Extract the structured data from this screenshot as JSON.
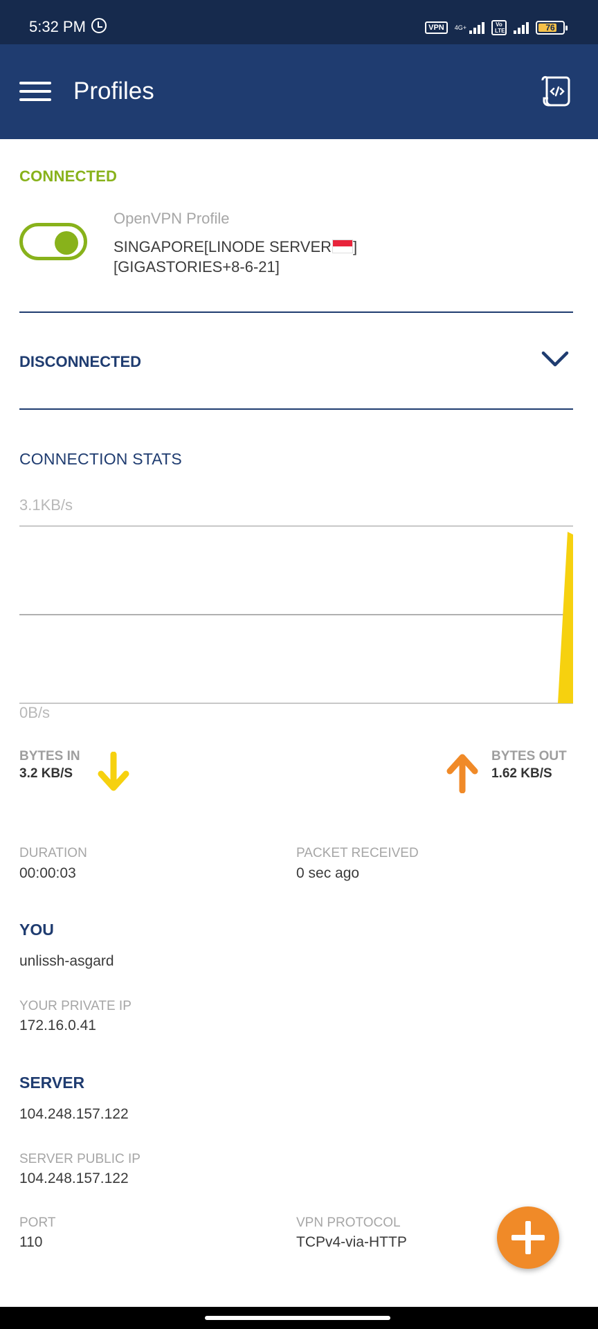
{
  "status_bar": {
    "time": "5:32 PM",
    "vpn_badge": "VPN",
    "network_type": "4G+",
    "volte_badge": "Vo LTE",
    "battery_level": "76",
    "battery_fraction": 0.76
  },
  "app_bar": {
    "title": "Profiles",
    "menu_icon": "hamburger-menu-icon",
    "log_icon": "log-file-icon"
  },
  "connected_section": {
    "label": "CONNECTED",
    "toggle_on": true,
    "profile_type": "OpenVPN Profile",
    "profile_name_line1": "SINGAPORE[LINODE SERVER",
    "profile_name_line2": "[GIGASTORIES+8-6-21]"
  },
  "disconnected_section": {
    "label": "DISCONNECTED"
  },
  "connection_stats": {
    "label": "CONNECTION STATS",
    "max_label": "3.1KB/s",
    "min_label": "0B/s",
    "bytes_in_label": "BYTES IN",
    "bytes_in_value": "3.2 KB/S",
    "bytes_out_label": "BYTES OUT",
    "bytes_out_value": "1.62 KB/S"
  },
  "chart_data": {
    "type": "area",
    "ylim": [
      0,
      3.1
    ],
    "series": [
      {
        "values": [
          0,
          0,
          0,
          0,
          0,
          0,
          0,
          0,
          0,
          3.0
        ]
      }
    ],
    "grid": true
  },
  "details": {
    "duration_label": "DURATION",
    "duration_value": "00:00:03",
    "packet_label": "PACKET RECEIVED",
    "packet_value": "0 sec ago",
    "you_label": "YOU",
    "you_value": "unlissh-asgard",
    "private_ip_label": "YOUR PRIVATE IP",
    "private_ip_value": "172.16.0.41",
    "server_label": "SERVER",
    "server_value": "104.248.157.122",
    "public_ip_label": "SERVER PUBLIC IP",
    "public_ip_value": "104.248.157.122",
    "port_label": "PORT",
    "port_value": "110",
    "protocol_label": "VPN PROTOCOL",
    "protocol_value": "TCPv4-via-HTTP"
  },
  "colors": {
    "app_bar": "#1f3c70",
    "status_bar": "#162a4d",
    "connected_green": "#88b21b",
    "chart_yellow": "#f6d10f",
    "bytes_in_arrow": "#f6d10f",
    "bytes_out_arrow": "#f08a28",
    "fab_orange": "#f08a28"
  }
}
